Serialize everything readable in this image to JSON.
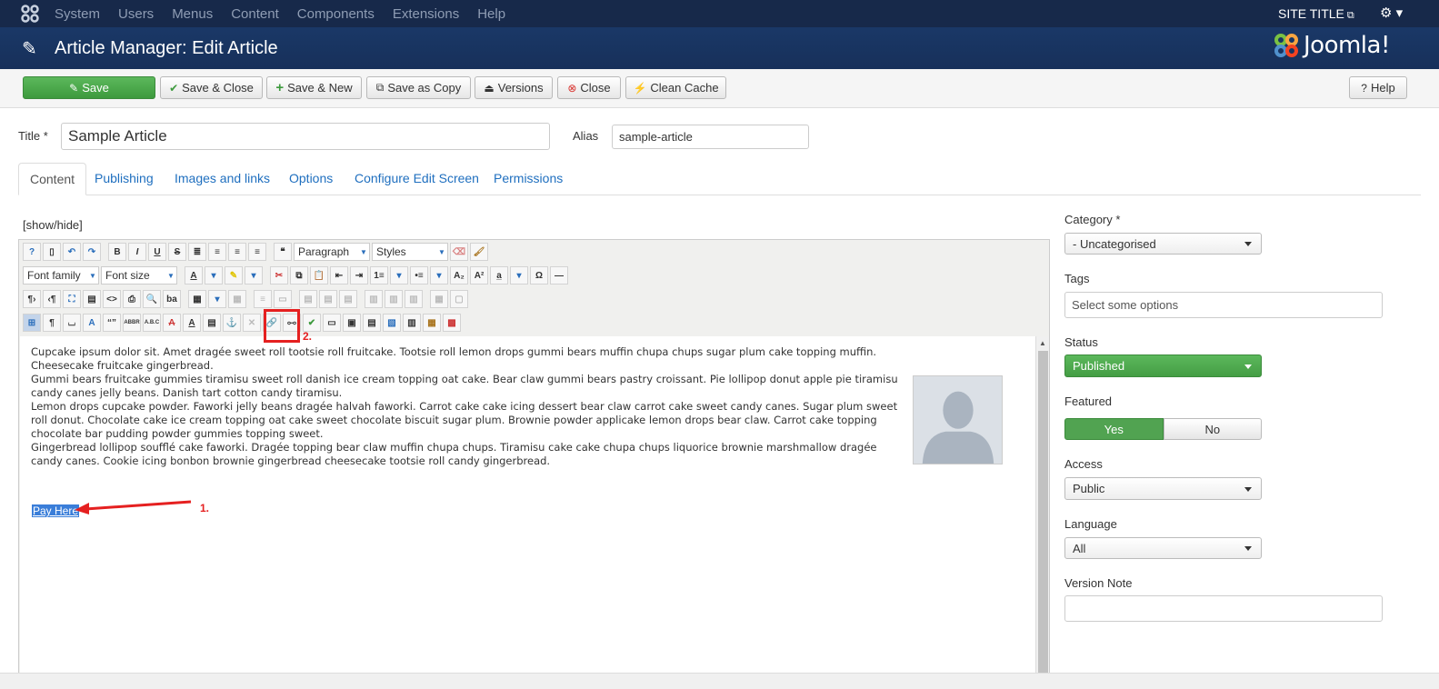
{
  "topnav": {
    "items": [
      "System",
      "Users",
      "Menus",
      "Content",
      "Components",
      "Extensions",
      "Help"
    ],
    "site_title": "SITE TITLE"
  },
  "header": {
    "title": "Article Manager: Edit Article",
    "logo_text": "Joomla!"
  },
  "toolbar": {
    "save": "Save",
    "save_close": "Save & Close",
    "save_new": "Save & New",
    "save_copy": "Save as Copy",
    "versions": "Versions",
    "close": "Close",
    "clean_cache": "Clean Cache",
    "help": "Help"
  },
  "form": {
    "title_label": "Title *",
    "title_value": "Sample Article",
    "alias_label": "Alias",
    "alias_value": "sample-article"
  },
  "tabs": [
    "Content",
    "Publishing",
    "Images and links",
    "Options",
    "Configure Edit Screen",
    "Permissions"
  ],
  "editor": {
    "show_hide": "[show/hide]",
    "format_select": "Paragraph",
    "styles_select": "Styles",
    "font_family_select": "Font family",
    "font_size_select": "Font size",
    "paragraphs": [
      "Cupcake ipsum dolor sit. Amet dragée sweet roll tootsie roll fruitcake. Tootsie roll lemon drops gummi bears muffin chupa chups sugar plum cake topping muffin. Cheesecake fruitcake gingerbread.",
      "Gummi bears fruitcake gummies tiramisu sweet roll danish ice cream topping oat cake. Bear claw gummi bears pastry croissant. Pie lollipop donut apple pie tiramisu candy canes jelly beans. Danish tart cotton candy tiramisu.",
      "Lemon drops cupcake powder. Faworki jelly beans dragée halvah faworki. Carrot cake cake icing dessert bear claw carrot cake sweet candy canes. Sugar plum sweet roll donut. Chocolate cake ice cream topping oat cake sweet chocolate biscuit sugar plum. Brownie powder applicake lemon drops bear claw. Carrot cake topping chocolate bar pudding powder gummies topping sweet.",
      "Gingerbread lollipop soufflé cake faworki. Dragée topping bear claw muffin chupa chups. Tiramisu cake cake chupa chups liquorice brownie marshmallow dragée candy canes. Cookie icing bonbon brownie gingerbread cheesecake tootsie roll candy gingerbread."
    ],
    "selected_text": "Pay Here"
  },
  "annotations": {
    "step1": "1.",
    "step2": "2."
  },
  "sidebar": {
    "category_label": "Category *",
    "category_value": "- Uncategorised",
    "tags_label": "Tags",
    "tags_placeholder": "Select some options",
    "status_label": "Status",
    "status_value": "Published",
    "featured_label": "Featured",
    "featured_yes": "Yes",
    "featured_no": "No",
    "access_label": "Access",
    "access_value": "Public",
    "language_label": "Language",
    "language_value": "All",
    "version_note_label": "Version Note",
    "version_note_value": ""
  },
  "colors": {
    "navbar": "#17294a",
    "header": "#1a3867",
    "success": "#5cb85c",
    "link": "#1f6fbf",
    "annotation": "#e52020"
  }
}
